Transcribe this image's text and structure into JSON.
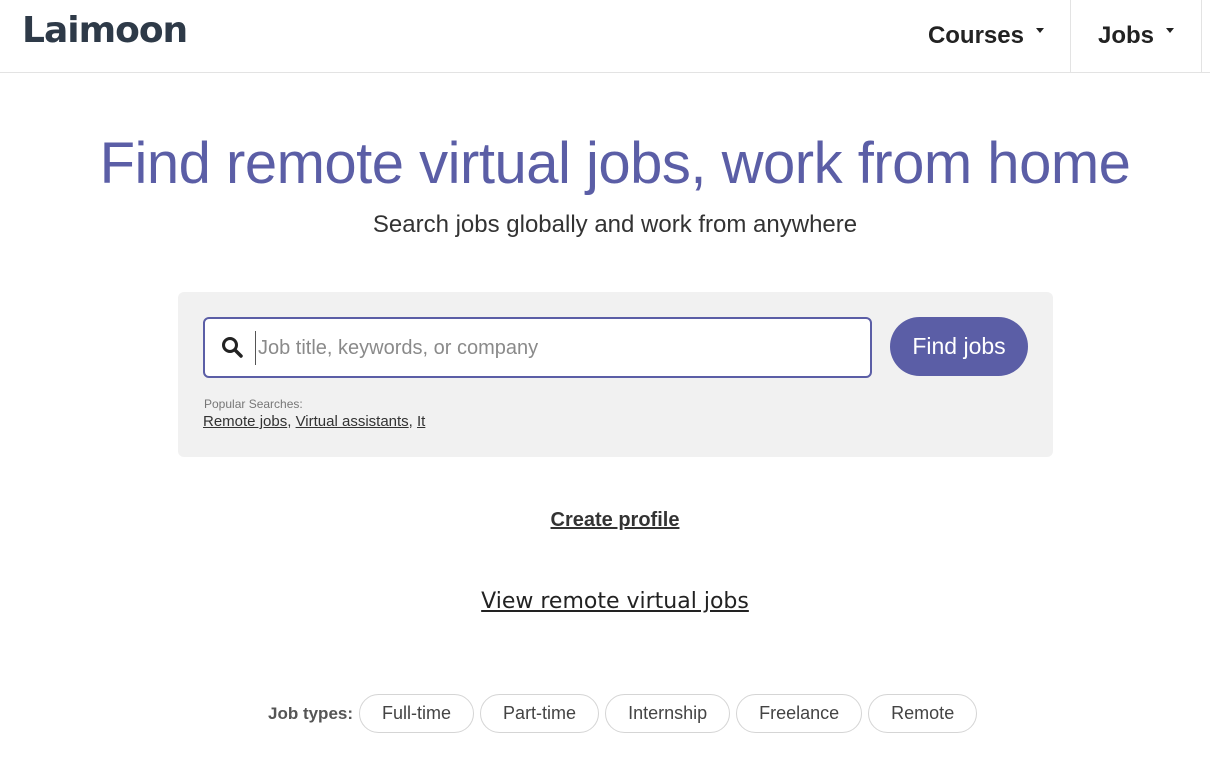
{
  "header": {
    "logo": "Laimoon",
    "nav": [
      {
        "label": "Courses"
      },
      {
        "label": "Jobs"
      }
    ]
  },
  "hero": {
    "title": "Find remote virtual jobs, work from home",
    "subtitle": "Search jobs globally and work from anywhere"
  },
  "search": {
    "placeholder": "Job title, keywords, or company",
    "value": "",
    "button_label": "Find jobs",
    "popular_label": "Popular Searches:",
    "popular": [
      "Remote jobs",
      "Virtual assistants",
      "It"
    ]
  },
  "links": {
    "create_profile": "Create profile",
    "view_jobs": "View remote virtual jobs"
  },
  "job_types": {
    "label": "Job types:",
    "items": [
      "Full-time",
      "Part-time",
      "Internship",
      "Freelance",
      "Remote"
    ]
  },
  "colors": {
    "accent": "#5b5ea6",
    "panel_bg": "#f1f1f1",
    "logo": "#2e3a48"
  },
  "icons": {
    "search": "search-icon",
    "caret": "chevron-down-icon"
  }
}
